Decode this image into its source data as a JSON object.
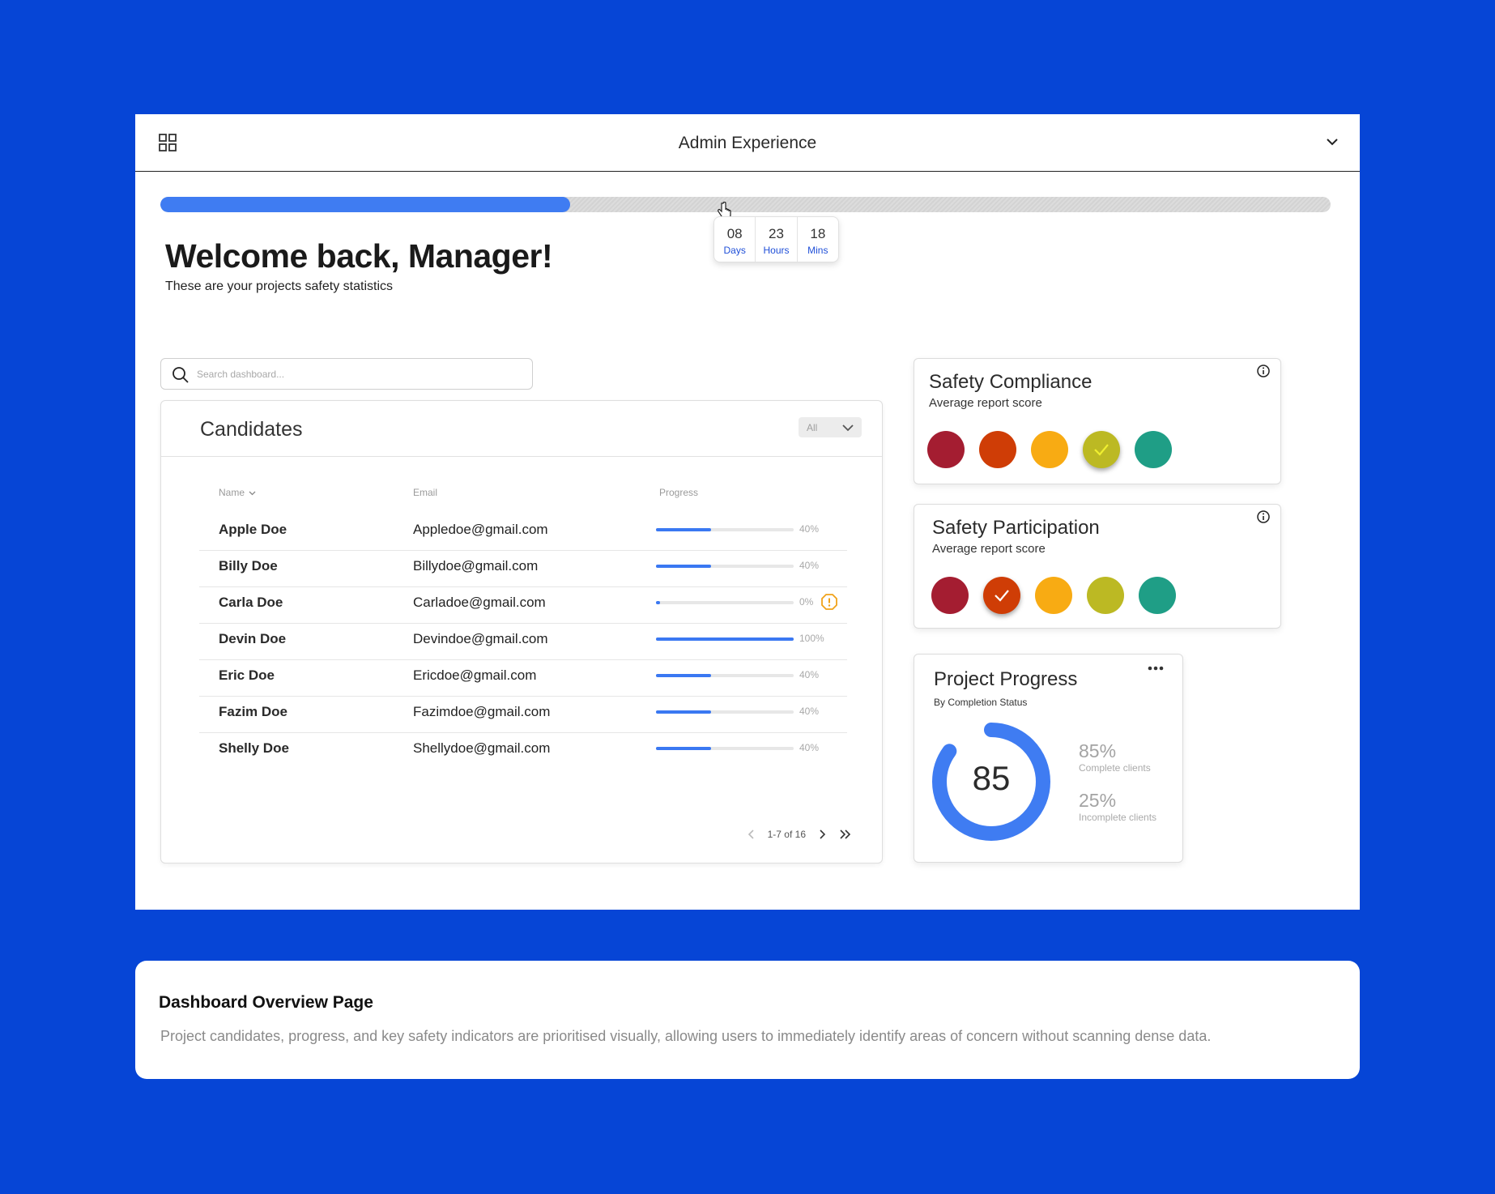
{
  "header": {
    "title": "Admin Experience"
  },
  "timeline": {
    "progress_percent": 35,
    "countdown": [
      {
        "value": "08",
        "unit": "Days"
      },
      {
        "value": "23",
        "unit": "Hours"
      },
      {
        "value": "18",
        "unit": "Mins"
      }
    ]
  },
  "welcome": {
    "title": "Welcome back, Manager!",
    "subtitle": "These are your projects safety statistics"
  },
  "search": {
    "placeholder": "Search dashboard..."
  },
  "candidates": {
    "title": "Candidates",
    "filter": "All",
    "columns": {
      "name": "Name",
      "email": "Email",
      "progress": "Progress"
    },
    "rows": [
      {
        "name": "Apple Doe",
        "email": "Appledoe@gmail.com",
        "progress": 40,
        "label": "40%",
        "warning": false
      },
      {
        "name": "Billy Doe",
        "email": "Billydoe@gmail.com",
        "progress": 40,
        "label": "40%",
        "warning": false
      },
      {
        "name": "Carla Doe",
        "email": "Carladoe@gmail.com",
        "progress": 0,
        "label": "0%",
        "warning": true
      },
      {
        "name": "Devin Doe",
        "email": "Devindoe@gmail.com",
        "progress": 100,
        "label": "100%",
        "warning": false
      },
      {
        "name": "Eric Doe",
        "email": "Ericdoe@gmail.com",
        "progress": 40,
        "label": "40%",
        "warning": false
      },
      {
        "name": "Fazim Doe",
        "email": "Fazimdoe@gmail.com",
        "progress": 40,
        "label": "40%",
        "warning": false
      },
      {
        "name": "Shelly Doe",
        "email": "Shellydoe@gmail.com",
        "progress": 40,
        "label": "40%",
        "warning": false
      }
    ],
    "pagination": "1-7 of 16"
  },
  "safety_compliance": {
    "title": "Safety Compliance",
    "subtitle": "Average report score",
    "selected_index": 3
  },
  "safety_participation": {
    "title": "Safety Participation",
    "subtitle": "Average report score",
    "selected_index": 1
  },
  "score_colors": [
    "#a41d31",
    "#cf3d06",
    "#f8ab13",
    "#bcb923",
    "#1f9e86"
  ],
  "check_colors": [
    "#ffffff",
    "#ffffff",
    "#ffffff",
    "#f0ef30",
    "#ffffff"
  ],
  "project_progress": {
    "title": "Project Progress",
    "subtitle": "By Completion Status",
    "value": "85",
    "fraction": 0.85,
    "complete_pct": "85%",
    "complete_label": "Complete clients",
    "incomplete_pct": "25%",
    "incomplete_label": "Incomplete clients",
    "ring_color": "#3f7cf2"
  },
  "caption": {
    "title": "Dashboard Overview Page",
    "text": "Project candidates, progress, and key safety indicators are prioritised visually, allowing users to immediately identify areas of concern without scanning dense data."
  }
}
